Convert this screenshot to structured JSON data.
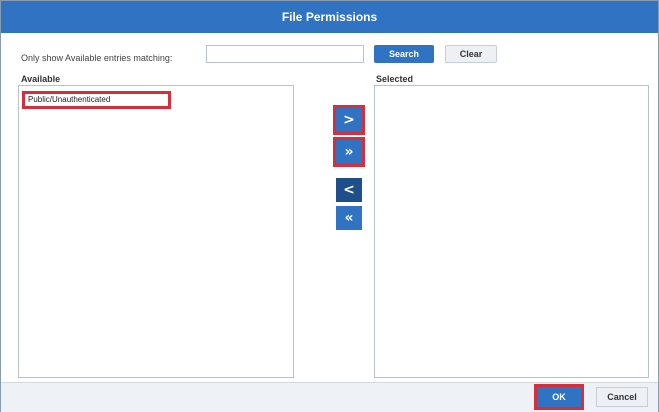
{
  "dialog": {
    "title": "File Permissions"
  },
  "filter": {
    "label": "Only show Available entries matching:",
    "value": "",
    "search_label": "Search",
    "clear_label": "Clear"
  },
  "available": {
    "label": "Available",
    "items": [
      "Public/Unauthenticated"
    ]
  },
  "selected": {
    "label": "Selected",
    "items": []
  },
  "move_buttons": {
    "add": ">",
    "add_all": "»",
    "remove": "<",
    "remove_all": "«"
  },
  "footer": {
    "ok_label": "OK",
    "cancel_label": "Cancel"
  },
  "colors": {
    "accent": "#2f73c2",
    "accent_dark": "#1f4f8a",
    "highlight": "#d62e3a"
  }
}
